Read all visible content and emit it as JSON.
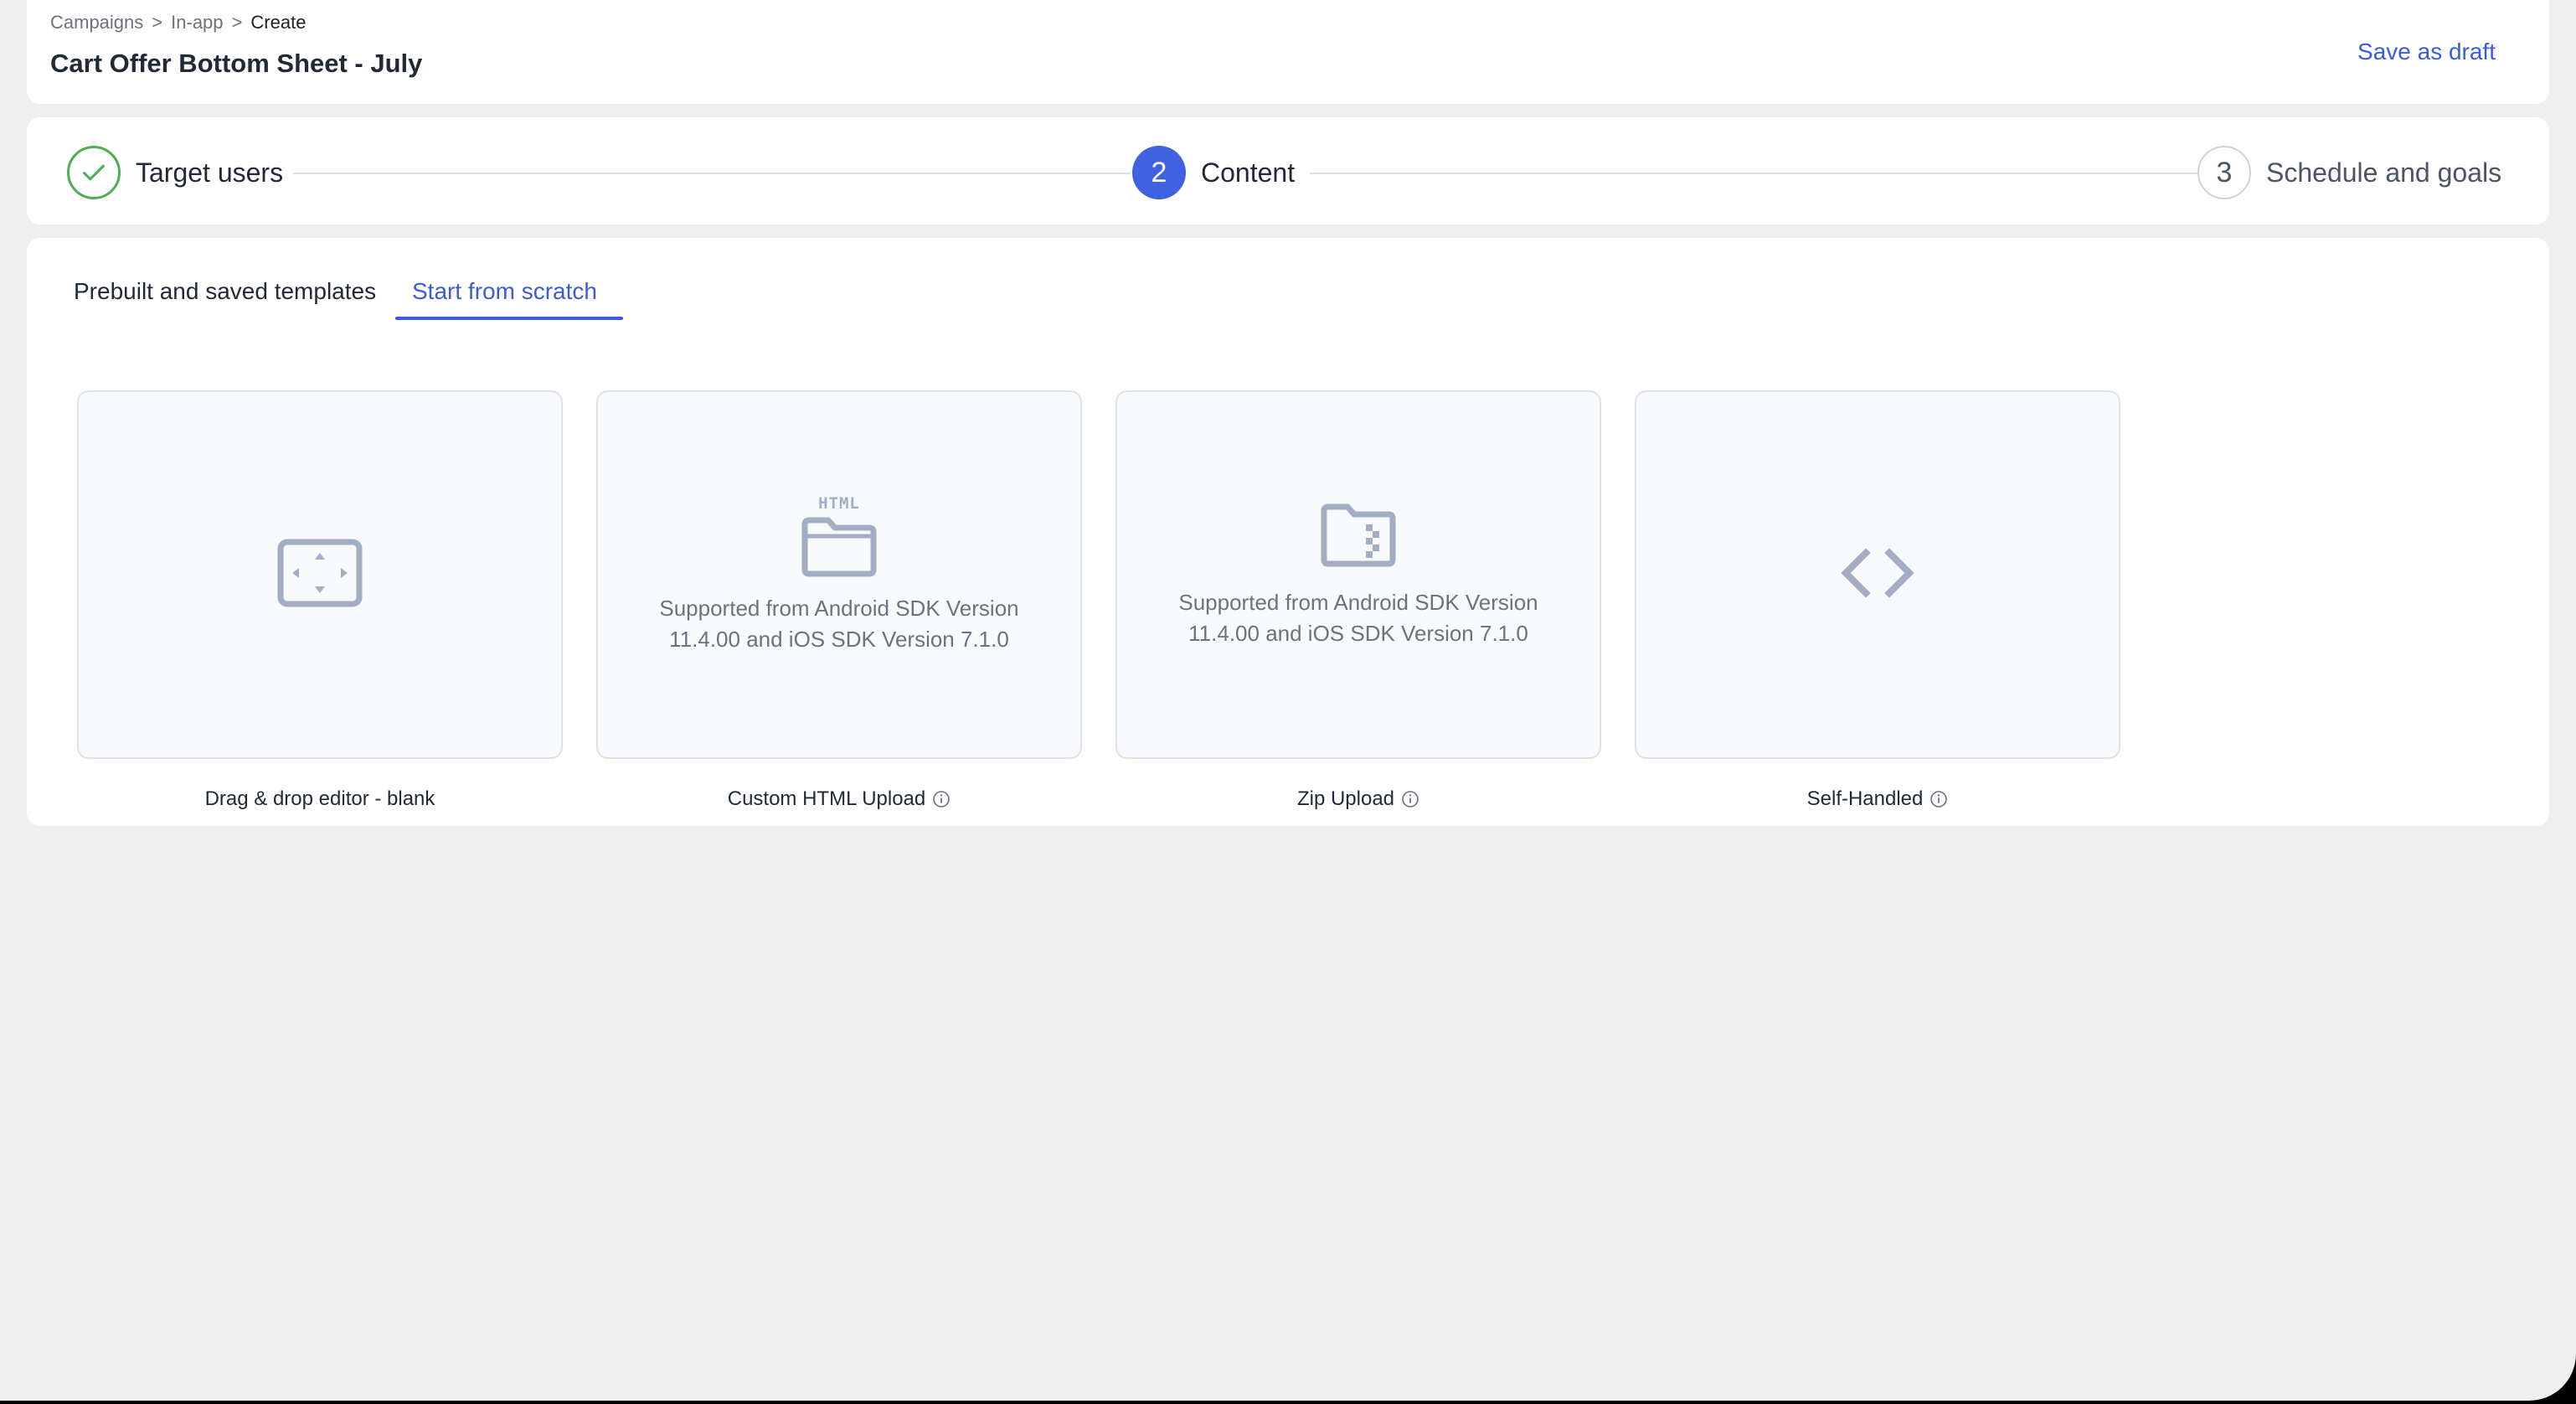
{
  "header": {
    "breadcrumb": [
      "Campaigns",
      "In-app",
      "Create"
    ],
    "breadcrumb_separator": ">",
    "title": "Cart Offer Bottom Sheet - July",
    "save_draft_label": "Save as draft"
  },
  "stepper": {
    "steps": [
      {
        "number": "1",
        "label": "Target users",
        "state": "completed"
      },
      {
        "number": "2",
        "label": "Content",
        "state": "active"
      },
      {
        "number": "3",
        "label": "Schedule and goals",
        "state": "pending"
      }
    ]
  },
  "templates": {
    "tabs": [
      {
        "label": "Prebuilt and saved templates",
        "active": false
      },
      {
        "label": "Start from scratch",
        "active": true
      }
    ],
    "tiles": [
      {
        "caption": "Drag & drop editor - blank",
        "icon": "drag-drop-editor-icon",
        "note": "",
        "has_info": false
      },
      {
        "caption": "Custom HTML Upload",
        "icon": "html-folder-icon",
        "icon_text": "HTML",
        "note": "Supported from Android SDK Version 11.4.00 and iOS SDK Version 7.1.0",
        "has_info": true
      },
      {
        "caption": "Zip Upload",
        "icon": "zip-folder-icon",
        "note": "Supported from Android SDK Version 11.4.00 and iOS SDK Version 7.1.0",
        "has_info": true
      },
      {
        "caption": "Self-Handled",
        "icon": "code-brackets-icon",
        "note": "",
        "has_info": true
      }
    ]
  },
  "colors": {
    "accent": "#3b5bd9",
    "active_step": "#3f63e0",
    "completed_step": "#4caf50",
    "icon_gray": "#a3aec4",
    "page_background": "#efefef"
  }
}
